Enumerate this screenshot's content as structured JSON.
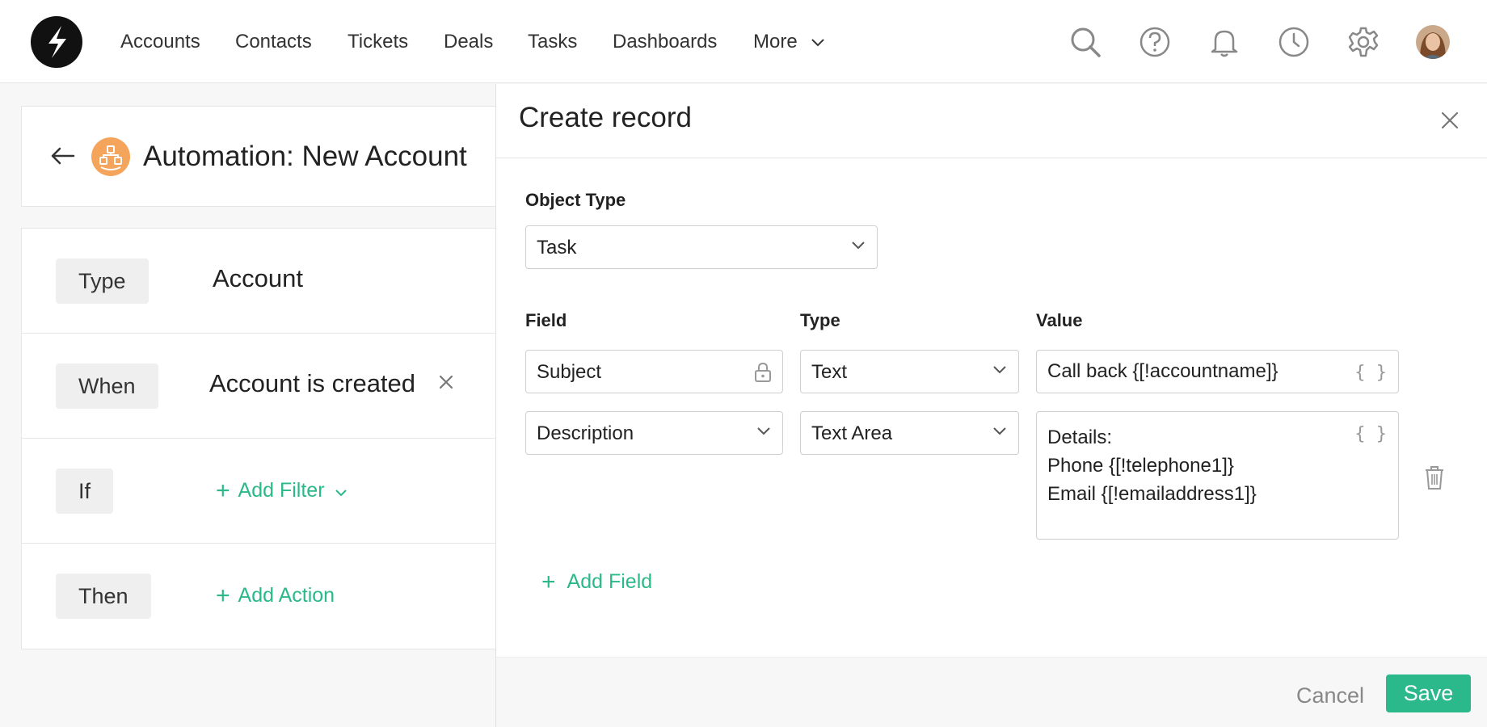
{
  "nav": {
    "items": [
      "Accounts",
      "Contacts",
      "Tickets",
      "Deals",
      "Tasks",
      "Dashboards",
      "More"
    ],
    "icons": [
      "search-icon",
      "help-icon",
      "bell-icon",
      "clock-icon",
      "gear-icon",
      "avatar"
    ]
  },
  "automation": {
    "title": "Automation: New Account",
    "rows": {
      "type": {
        "label": "Type",
        "value": "Account"
      },
      "when": {
        "label": "When",
        "value": "Account is created"
      },
      "if": {
        "label": "If",
        "action": "Add Filter"
      },
      "then": {
        "label": "Then",
        "action": "Add Action"
      }
    }
  },
  "drawer": {
    "title": "Create record",
    "object_type_label": "Object Type",
    "object_type_value": "Task",
    "col_field": "Field",
    "col_type": "Type",
    "col_value": "Value",
    "fields": [
      {
        "field": "Subject",
        "type": "Text",
        "value": "Call back {[!accountname]}"
      },
      {
        "field": "Description",
        "type": "Text Area",
        "value_lines": [
          "Details:",
          "Phone {[!telephone1]}",
          "Email {[!emailaddress1]}"
        ]
      }
    ],
    "braces": "{ }",
    "add_field": "Add Field",
    "cancel": "Cancel",
    "save": "Save"
  },
  "colors": {
    "accent": "#2bb88a",
    "automation_icon": "#f5a55b"
  }
}
